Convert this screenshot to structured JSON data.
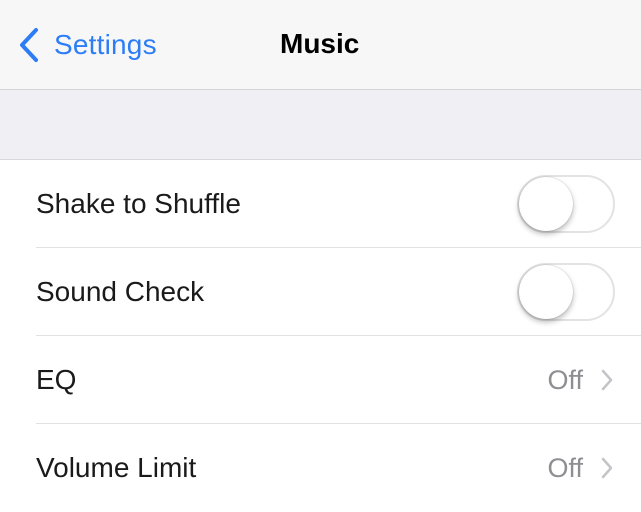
{
  "navbar": {
    "back_label": "Settings",
    "title": "Music"
  },
  "rows": [
    {
      "label": "Shake to Shuffle",
      "type": "switch",
      "on": false
    },
    {
      "label": "Sound Check",
      "type": "switch",
      "on": false
    },
    {
      "label": "EQ",
      "type": "detail",
      "value": "Off"
    },
    {
      "label": "Volume Limit",
      "type": "detail",
      "value": "Off"
    }
  ],
  "colors": {
    "accent": "#2d7df6",
    "secondary_text": "#8e8e93",
    "group_background": "#efeff4"
  },
  "icons": {
    "back": "chevron-left-icon",
    "disclosure": "chevron-right-icon"
  }
}
